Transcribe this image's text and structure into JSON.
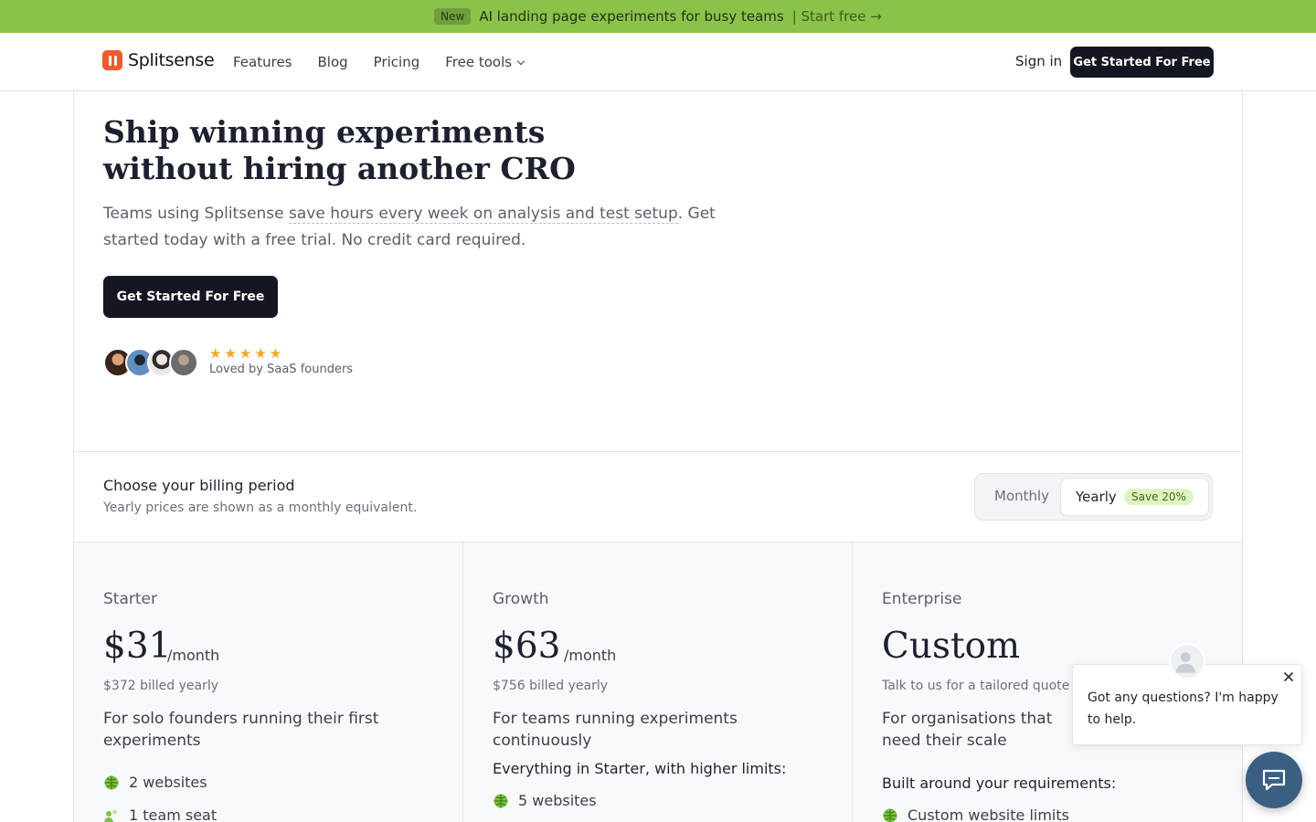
{
  "banner": {
    "tag": "New",
    "message": "AI landing page experiments for busy teams",
    "cta": "| Start free →"
  },
  "nav": {
    "brand": "Splitsense",
    "links": [
      "Features",
      "Blog",
      "Pricing",
      "Free tools"
    ],
    "sign_in": "Sign in",
    "cta": "Get Started For Free"
  },
  "hero": {
    "title_line1": "Ship winning experiments",
    "title_line2": "without hiring another CRO",
    "sub_before": "Teams using Splitsense ",
    "sub_highlight": "save hours every week on analysis and test setup",
    "sub_after": ". Get started today with a free trial. No credit card required.",
    "cta": "Get Started For Free",
    "rating": "★★★★★",
    "loved_by": "Loved by SaaS founders"
  },
  "billing": {
    "title": "Choose your billing period",
    "note": "Yearly prices are shown as a monthly equivalent.",
    "monthly": "Monthly",
    "yearly": "Yearly",
    "save_badge": "Save 20%"
  },
  "plans": [
    {
      "name": "Starter",
      "price": "$31",
      "period": "/month",
      "billed": "$372 billed yearly",
      "description": "For solo founders running their first experiments",
      "features": [
        "2 websites",
        "1 team seat"
      ]
    },
    {
      "name": "Growth",
      "price": "$63",
      "period": "/month",
      "billed": "$756 billed yearly",
      "description": "For teams running experiments continuously",
      "subheading": "Everything in Starter, with higher limits:",
      "features": [
        "5 websites"
      ]
    },
    {
      "name": "Enterprise",
      "price": "Custom",
      "billed": "Talk to us for a tailored quote",
      "description": "For organisations that need their scale",
      "subheading": "Built around your requirements:",
      "features": [
        "Custom website limits"
      ]
    }
  ],
  "chat": {
    "message": "Got any questions? I'm happy to help."
  },
  "colors": {
    "banner": "#8bc34a",
    "brand": "#ef5a2e",
    "primary_button": "#141721",
    "save_badge_bg": "#dff3c2",
    "feature_icon": "#7cc242",
    "chat_launcher": "#3a5f83",
    "stars": "#f6a623"
  }
}
